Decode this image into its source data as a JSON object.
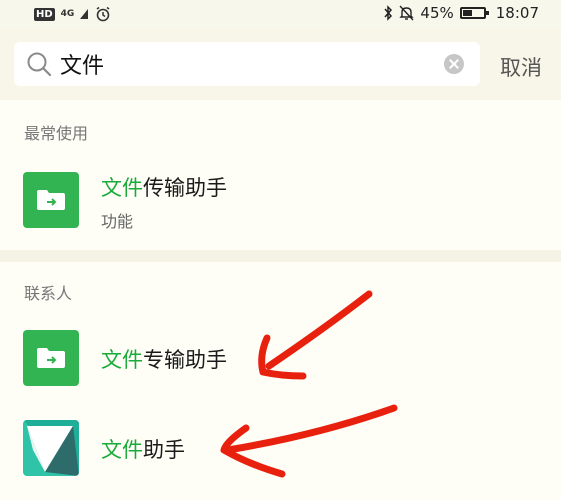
{
  "status_bar": {
    "hd": "HD",
    "network": "4G",
    "battery_percent": "45%",
    "battery_level": 0.45,
    "time": "18:07",
    "icons": [
      "alarm-icon",
      "bluetooth-icon",
      "mute-icon",
      "battery-icon"
    ]
  },
  "search": {
    "value": "文件",
    "cancel_label": "取消"
  },
  "sections": {
    "recent_label": "最常使用",
    "contacts_label": "联系人"
  },
  "results": [
    {
      "highlight": "文件",
      "rest": "传输助手",
      "subtitle": "功能",
      "icon": "file-transfer-icon"
    },
    {
      "highlight": "文件",
      "rest": "专输助手",
      "icon": "file-transfer-icon"
    },
    {
      "highlight": "文件",
      "rest": "助手",
      "icon": "teal-paper-icon"
    }
  ],
  "colors": {
    "highlight": "#1aaa3a",
    "icon_green": "#33b453",
    "annotation_red": "#e8210f"
  }
}
